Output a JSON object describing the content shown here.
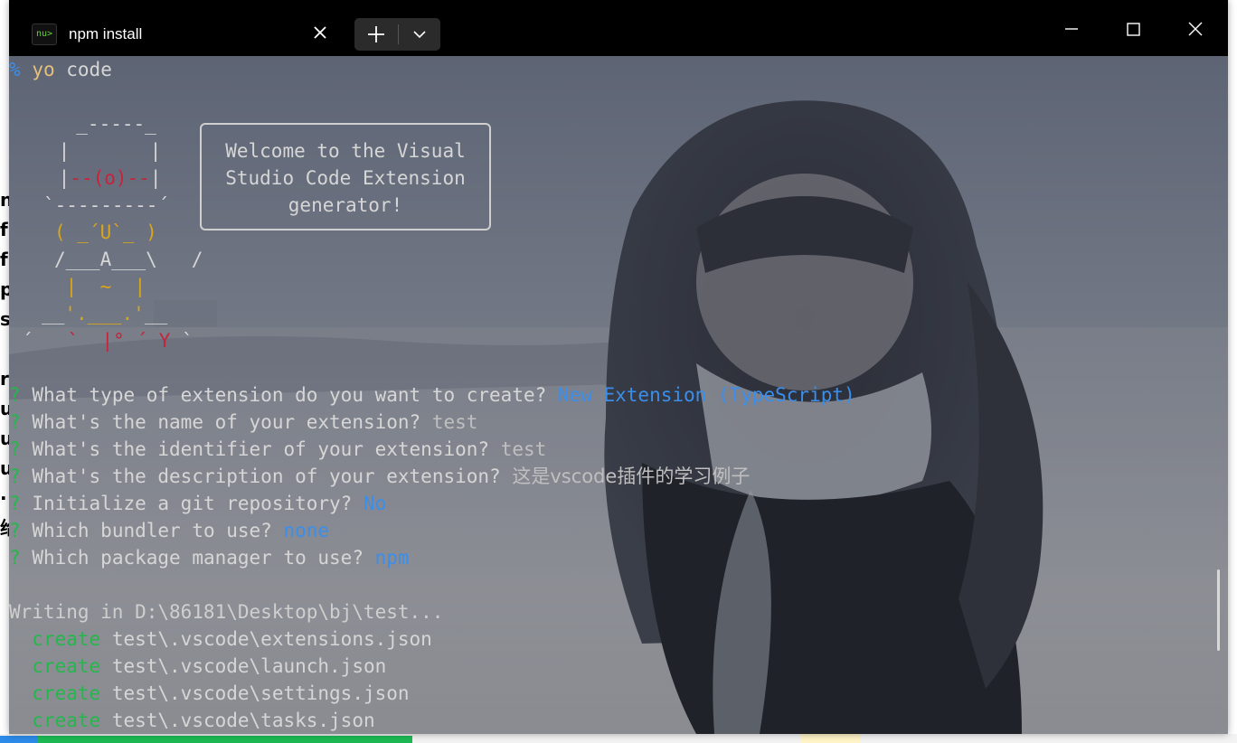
{
  "window": {
    "tab_title": "npm install",
    "tab_icon_text": "nu>"
  },
  "icons": {
    "tab_close": "close-icon",
    "new_tab": "plus-icon",
    "dropdown": "chevron-down-icon",
    "minimize": "minimize-icon",
    "maximize": "maximize-icon",
    "close": "close-icon"
  },
  "terminal": {
    "prompt_symbol": "%",
    "command_name": "yo",
    "command_arg": "code",
    "welcome_lines": [
      "Welcome to the Visual",
      "Studio Code Extension",
      "generator!"
    ],
    "yeoman_art": {
      "l1": "  _-----_",
      "l2": " |       |",
      "l3_a": " |",
      "l3_b": "--(o)--",
      "l3_c": "|",
      "l4": "`---------´",
      "l5": "( _´U`_ )",
      "l6": "/___A___\\   /",
      "l7": " |  ~  |",
      "l8_a": "__",
      "l8_b": "'.___.'",
      "l8_c": "__",
      "l9_a": "´   ",
      "l9_b": "`  |",
      "l9_c": "° ´ Y",
      "l9_d": " `"
    },
    "qa": [
      {
        "q": "What type of extension do you want to create?",
        "a": "New Extension (TypeScript)",
        "answer_style": "blue"
      },
      {
        "q": "What's the name of your extension?",
        "a": "test",
        "answer_style": "grey"
      },
      {
        "q": "What's the identifier of your extension?",
        "a": "test",
        "answer_style": "grey"
      },
      {
        "q": "What's the description of your extension?",
        "a": "这是vscode插件的学习例子",
        "answer_style": "grey"
      },
      {
        "q": "Initialize a git repository?",
        "a": "No",
        "answer_style": "blue"
      },
      {
        "q": "Which bundler to use?",
        "a": "none",
        "answer_style": "blue"
      },
      {
        "q": "Which package manager to use?",
        "a": "npm",
        "answer_style": "blue"
      }
    ],
    "question_mark": "?",
    "writing_line": "Writing in D:\\86181\\Desktop\\bj\\test...",
    "create_label": "create",
    "created_files": [
      "test\\.vscode\\extensions.json",
      "test\\.vscode\\launch.json",
      "test\\.vscode\\settings.json",
      "test\\.vscode\\tasks.json"
    ]
  },
  "desktop_residue": {
    "letters": [
      "n",
      "f",
      "f",
      "p",
      "s",
      "",
      "r",
      "u",
      "u",
      "u",
      "·",
      "给"
    ]
  },
  "colors": {
    "answer_blue": "#3b8eea",
    "question_green": "#23b74c",
    "art_gold": "#d7a61b",
    "art_red": "#c8233a"
  }
}
